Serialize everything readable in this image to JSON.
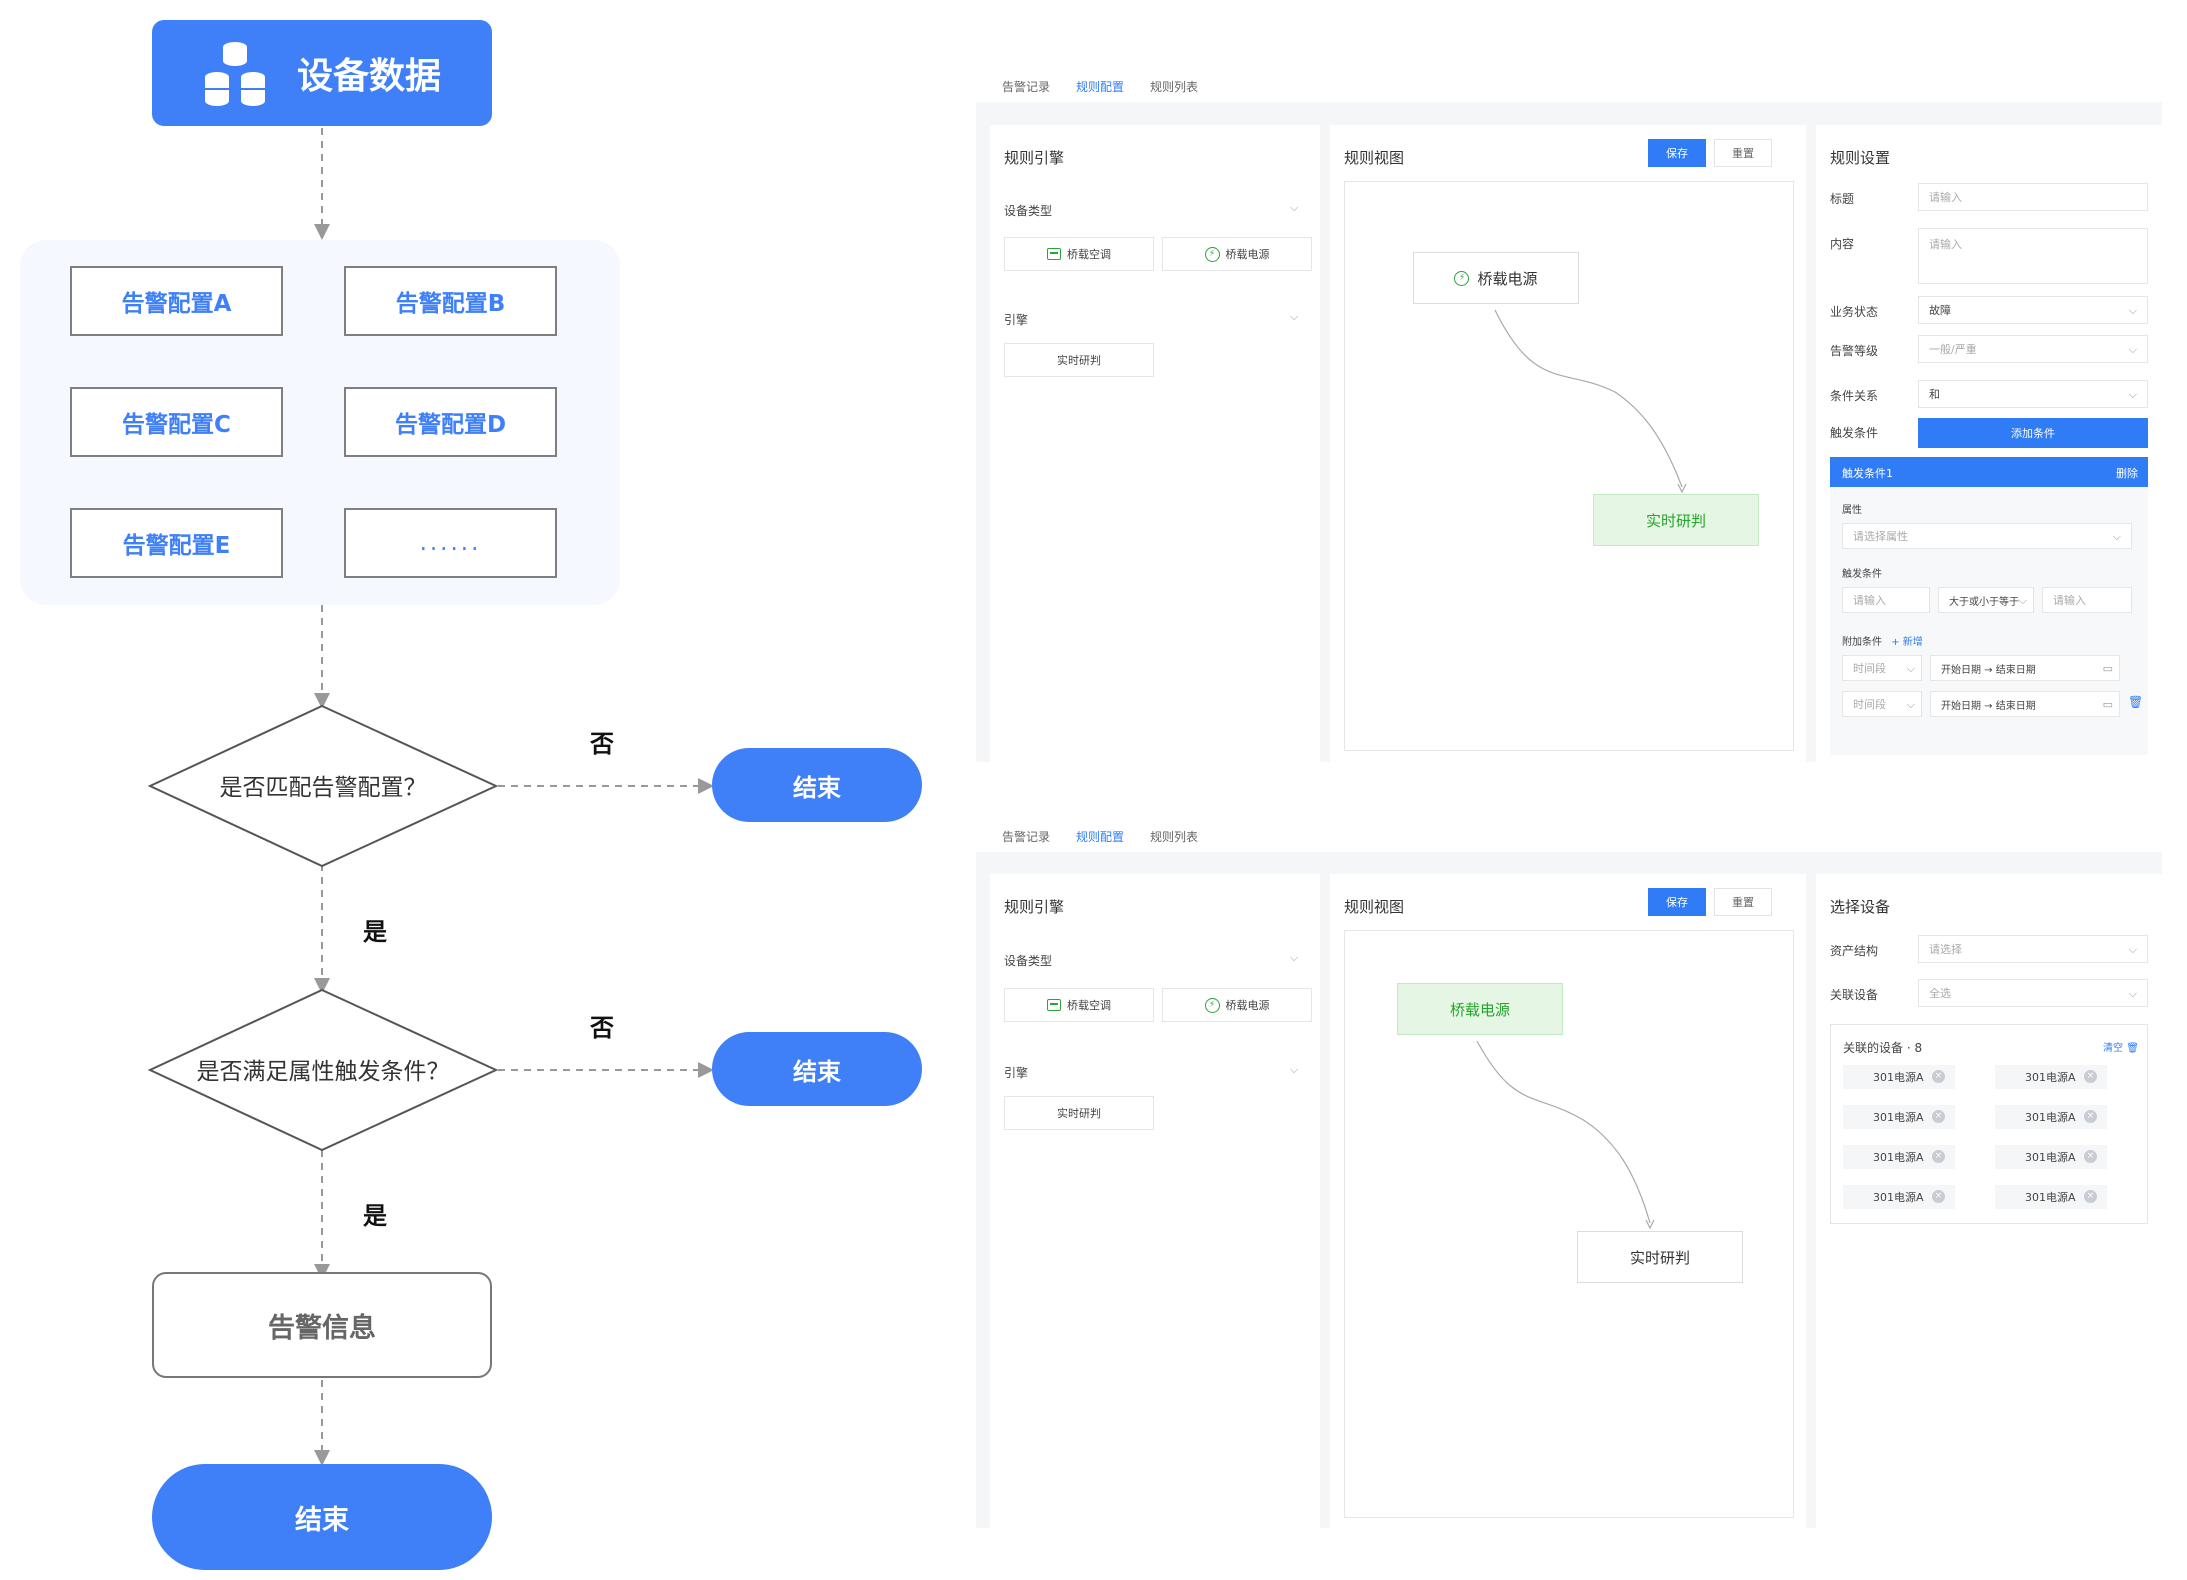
{
  "flowchart": {
    "start_node": "设备数据",
    "configs": [
      "告警配置A",
      "告警配置B",
      "告警配置C",
      "告警配置D",
      "告警配置E",
      "......"
    ],
    "decision1": "是否匹配告警配置？",
    "decision2": "是否满足属性触发条件？",
    "yes_label": "是",
    "no_label": "否",
    "end_label": "结束",
    "info_node": "告警信息"
  },
  "screen1": {
    "tabs": [
      "告警记录",
      "规则配置",
      "规则列表"
    ],
    "left": {
      "title": "规则引擎",
      "device_type_label": "设备类型",
      "devices": [
        "桥载空调",
        "桥载电源"
      ],
      "engine_label": "引擎",
      "engine_item": "实时研判"
    },
    "center": {
      "title": "规则视图",
      "save": "保存",
      "reset": "重置",
      "node_source": "桥载电源",
      "node_target": "实时研判"
    },
    "right": {
      "title": "规则设置",
      "title_label": "标题",
      "title_placeholder": "请输入",
      "content_label": "内容",
      "content_placeholder": "请输入",
      "status_label": "业务状态",
      "status_value": "故障",
      "level_label": "告警等级",
      "level_value": "一般/严重",
      "relation_label": "条件关系",
      "relation_value": "和",
      "trigger_label": "触发条件",
      "add_condition": "添加条件",
      "cond_header": "触发条件1",
      "cond_delete": "删除",
      "attr_label": "属性",
      "attr_placeholder": "请选择属性",
      "trigger_cond_label": "触发条件",
      "input_placeholder": "请输入",
      "operator": "大于或小于等于",
      "extra_label": "附加条件",
      "extra_add": "+ 新增",
      "time_label": "时间段",
      "date_range": "开始日期 → 结束日期"
    }
  },
  "screen2": {
    "tabs": [
      "告警记录",
      "规则配置",
      "规则列表"
    ],
    "left": {
      "title": "规则引擎",
      "device_type_label": "设备类型",
      "devices": [
        "桥载空调",
        "桥载电源"
      ],
      "engine_label": "引擎",
      "engine_item": "实时研判"
    },
    "center": {
      "title": "规则视图",
      "save": "保存",
      "reset": "重置",
      "node_source": "桥载电源",
      "node_target": "实时研判"
    },
    "right": {
      "title": "选择设备",
      "asset_label": "资产结构",
      "asset_placeholder": "请选择",
      "linked_label": "关联设备",
      "linked_value": "全选",
      "count_label": "关联的设备 · 8",
      "clear": "清空",
      "devices": [
        "301电源A",
        "301电源A",
        "301电源A",
        "301电源A",
        "301电源A",
        "301电源A",
        "301电源A",
        "301电源A"
      ]
    }
  },
  "colors": {
    "accent": "#3f80f8",
    "primary": "#2f7cf6",
    "green": "#25a42c"
  }
}
